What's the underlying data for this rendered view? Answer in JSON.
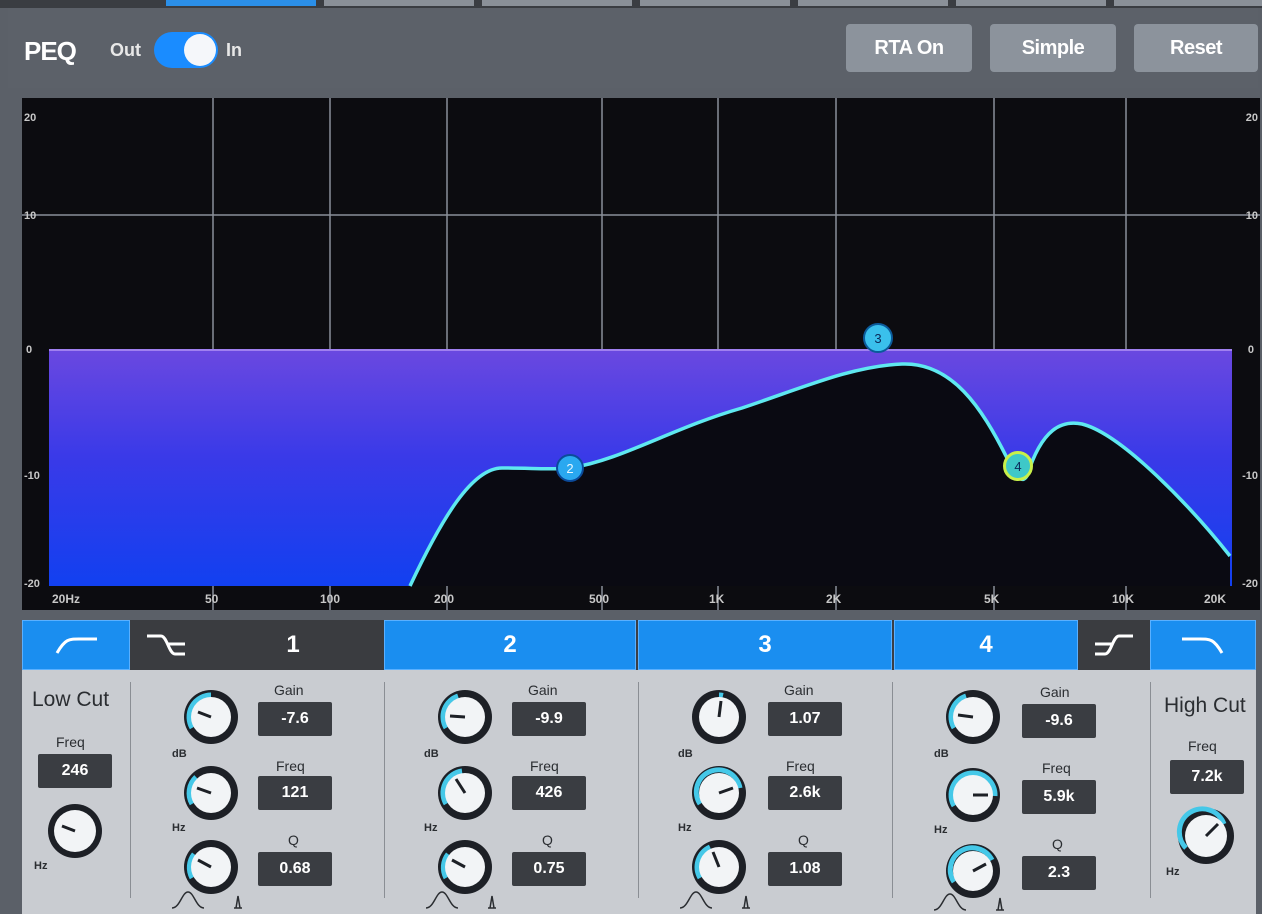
{
  "header": {
    "title": "PEQ",
    "toggle_out_label": "Out",
    "toggle_in_label": "In",
    "toggle_state": "In",
    "buttons": {
      "rta": "RTA On",
      "simple": "Simple",
      "reset": "Reset"
    }
  },
  "graph": {
    "y_ticks": [
      "20",
      "10",
      "0",
      "-10",
      "-20"
    ],
    "x_ticks": [
      "20Hz",
      "50",
      "100",
      "200",
      "500",
      "1K",
      "2K",
      "5K",
      "10K",
      "20K"
    ],
    "markers": [
      "2",
      "3",
      "4"
    ],
    "curve_color": "#5fe8f0"
  },
  "band_bar": {
    "bands": [
      "1",
      "2",
      "3",
      "4"
    ],
    "low_cut_icon": "low-cut-shape-icon",
    "high_cut_icon": "high-cut-shape-icon"
  },
  "low_cut": {
    "title": "Low Cut",
    "freq_label": "Freq",
    "freq_value": "246",
    "unit": "Hz"
  },
  "high_cut": {
    "title": "High Cut",
    "freq_label": "Freq",
    "freq_value": "7.2k",
    "unit": "Hz"
  },
  "bands": [
    {
      "name": "1",
      "gain_label": "Gain",
      "gain": "-7.6",
      "freq_label": "Freq",
      "freq": "121",
      "q_label": "Q",
      "q": "0.68",
      "gain_unit": "dB",
      "freq_unit": "Hz"
    },
    {
      "name": "2",
      "gain_label": "Gain",
      "gain": "-9.9",
      "freq_label": "Freq",
      "freq": "426",
      "q_label": "Q",
      "q": "0.75",
      "gain_unit": "dB",
      "freq_unit": "Hz"
    },
    {
      "name": "3",
      "gain_label": "Gain",
      "gain": "1.07",
      "freq_label": "Freq",
      "freq": "2.6k",
      "q_label": "Q",
      "q": "1.08",
      "gain_unit": "dB",
      "freq_unit": "Hz"
    },
    {
      "name": "4",
      "gain_label": "Gain",
      "gain": "-9.6",
      "freq_label": "Freq",
      "freq": "5.9k",
      "q_label": "Q",
      "q": "2.3",
      "gain_unit": "dB",
      "freq_unit": "Hz"
    }
  ],
  "colors": {
    "accent": "#1a8ef0",
    "panel": "#c9ccd1",
    "value_box": "#3a3d42",
    "knob_ring": "#45c8e8"
  }
}
